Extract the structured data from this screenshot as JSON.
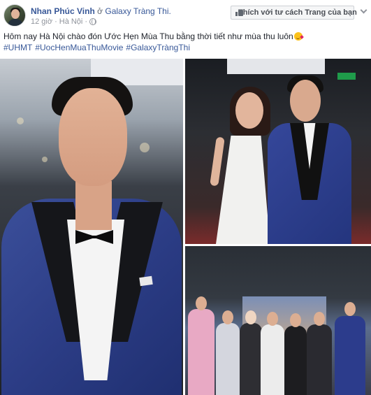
{
  "post": {
    "author_name": "Nhan Phúc Vinh",
    "location_prep": "ở",
    "location_name": "Galaxy Tràng Thi.",
    "time_ago": "12 giờ",
    "separator": "·",
    "city": "Hà Nội",
    "separator2": "·",
    "interact_button_label": "Thích với tư cách Trang của bạn",
    "message": "Hôm nay Hà Nội chào đón Ước Hẹn Mùa Thu bằng thời tiết như mùa thu luôn",
    "hashtags": [
      "#UHMT",
      "#UocHenMuaThuMovie",
      "#GalaxyTràngThi"
    ]
  },
  "icons": {
    "interact": "thumbs-up-icon",
    "privacy": "globe-icon",
    "menu": "chevron-down-icon",
    "emoji": "blowing-kiss-emoji-icon"
  },
  "photos": [
    {
      "subject": "man in blue tuxedo with black bow tie"
    },
    {
      "subject": "couple, woman in white music-note dress and man in blue tuxedo"
    },
    {
      "subject": "group of eight people at movie premiere"
    }
  ],
  "colors": {
    "link": "#385898",
    "meta": "#90949c",
    "text": "#1d2129",
    "button_bg": "#f5f6f7"
  }
}
